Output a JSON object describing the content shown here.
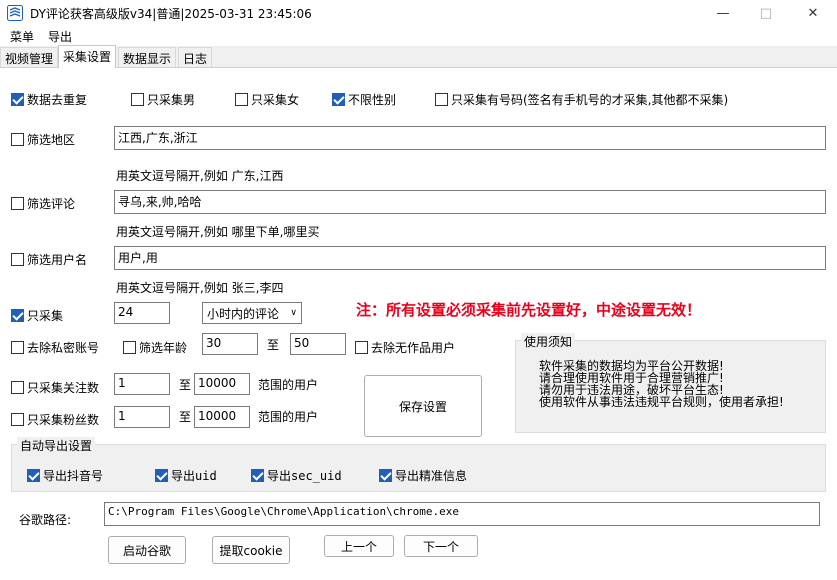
{
  "window": {
    "title": "DY评论获客高级版v34|普通|2025-03-31 23:45:06",
    "min_icon": "minimize-icon",
    "max_icon": "maximize-icon",
    "close_icon": "close-icon"
  },
  "menu": {
    "items": [
      "菜单",
      "导出"
    ]
  },
  "tabs": [
    "视频管理",
    "采集设置",
    "数据显示",
    "日志"
  ],
  "filters": {
    "dedupe": {
      "label": "数据去重复",
      "checked": true
    },
    "male_only": {
      "label": "只采集男",
      "checked": false
    },
    "female_only": {
      "label": "只采集女",
      "checked": false
    },
    "any_gender": {
      "label": "不限性别",
      "checked": true
    },
    "phone_only": {
      "label": "只采集有号码(签名有手机号的才采集,其他都不采集)",
      "checked": false
    }
  },
  "region": {
    "label": "筛选地区",
    "checked": false,
    "value": "江西,广东,浙江",
    "hint": "用英文逗号隔开,例如 广东,江西"
  },
  "comment": {
    "label": "筛选评论",
    "checked": false,
    "value": "寻乌,来,帅,哈哈",
    "hint": "用英文逗号隔开,例如  哪里下单,哪里买"
  },
  "username": {
    "label": "筛选用户名",
    "checked": false,
    "value": "用户,用",
    "hint": "用英文逗号隔开,例如  张三,李四"
  },
  "only_collect": {
    "label": "只采集",
    "checked": true,
    "value": "24",
    "select": "小时内的评论"
  },
  "notice_red": "注：所有设置必须采集前先设置好，中途设置无效！",
  "private": {
    "label": "去除私密账号",
    "checked": false
  },
  "age": {
    "label": "筛选年龄",
    "checked": false,
    "from": "30",
    "sep": "至",
    "to": "50"
  },
  "no_works": {
    "label": "去除无作品用户",
    "checked": false
  },
  "follow": {
    "label": "只采集关注数",
    "checked": false,
    "from": "1",
    "sep": "至",
    "to": "10000",
    "suffix": "范围的用户"
  },
  "fans": {
    "label": "只采集粉丝数",
    "checked": false,
    "from": "1",
    "sep": "至",
    "to": "10000",
    "suffix": "范围的用户"
  },
  "save_button": "保存设置",
  "usage": {
    "title": "使用须知",
    "lines": [
      "软件采集的数据均为平台公开数据!",
      "请合理使用软件用于合理营销推广!",
      "请勿用于违法用途，破坏平台生态!",
      "使用软件从事违法违规平台规则，使用者承担!"
    ]
  },
  "auto_export": {
    "title": "自动导出设置",
    "douyin": {
      "label": "导出抖音号",
      "checked": true
    },
    "uid": {
      "label": "导出uid",
      "checked": true
    },
    "sec_uid": {
      "label": "导出sec_uid",
      "checked": true
    },
    "precise": {
      "label": "导出精准信息",
      "checked": true
    }
  },
  "chrome": {
    "label": "谷歌路径:",
    "path": "C:\\Program Files\\Google\\Chrome\\Application\\chrome.exe"
  },
  "buttons": {
    "launch": "启动谷歌",
    "cookie": "提取cookie",
    "prev": "上一个",
    "next": "下一个"
  },
  "colors": {
    "accent": "#1f5fb8",
    "notice": "#e8001c"
  }
}
